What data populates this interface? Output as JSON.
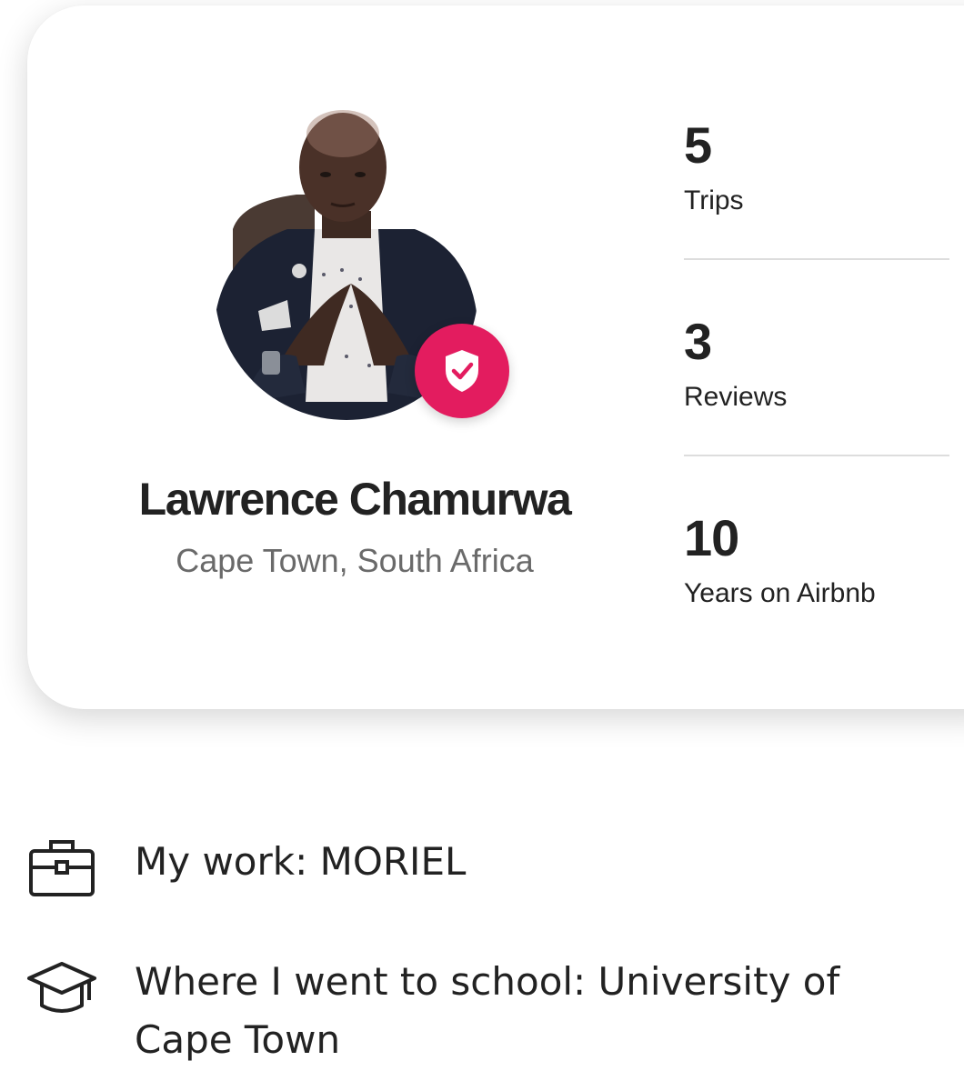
{
  "profile": {
    "name": "Lawrence Chamurwa",
    "location": "Cape Town, South Africa",
    "verified": true
  },
  "stats": [
    {
      "value": "5",
      "label": "Trips"
    },
    {
      "value": "3",
      "label": "Reviews"
    },
    {
      "value": "10",
      "label": "Years on Airbnb"
    }
  ],
  "about": [
    {
      "icon": "briefcase-icon",
      "text": "My work: MORIEL"
    },
    {
      "icon": "graduation-cap-icon",
      "text": "Where I went to school: University of Cape Town"
    }
  ],
  "colors": {
    "accent": "#e31c5f",
    "text": "#222222",
    "muted": "#6a6a6a",
    "divider": "#dddddd"
  },
  "icons": {
    "verified_badge": "shield-check-icon"
  }
}
